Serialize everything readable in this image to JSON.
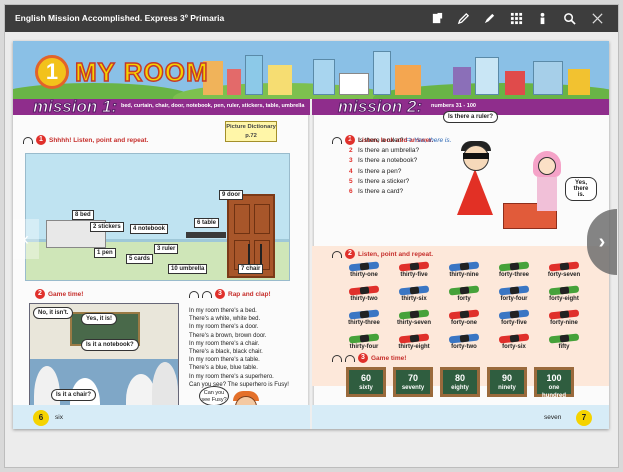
{
  "app": {
    "title": "English Mission Accomplished. Express 3º Primaria"
  },
  "toolbar": {
    "icons": [
      "notes-icon",
      "pencil-icon",
      "marker-icon",
      "grid-icon",
      "ruler-icon",
      "search-icon",
      "close-icon"
    ]
  },
  "left_page": {
    "unit_number": "1",
    "unit_title": "MY ROOM",
    "mission_title": "mission 1:",
    "mission_subtitle": "bed, curtain, chair, door, notebook, pen, ruler, stickers, table, umbrella",
    "exercise1": {
      "number": "1",
      "text": "Shhhh! Listen, point and repeat."
    },
    "picture_dictionary": "Picture Dictionary p.72",
    "room_labels": [
      "9 door",
      "8 bed",
      "2 stickers",
      "4 notebook",
      "6 table",
      "1 pen",
      "5 cards",
      "3 ruler",
      "10 umbrella",
      "7 chair"
    ],
    "exercise2": {
      "number": "2",
      "text": "Game time!"
    },
    "exercise3": {
      "number": "3",
      "text": "Rap and clap!"
    },
    "bubbles": [
      "No, it isn't.",
      "Yes, it is!",
      "Is it a notebook?",
      "Is it a chair?"
    ],
    "poem": [
      "In my room there's a bed.",
      "There's a white, white bed.",
      "In my room there's a door.",
      "There's a brown, brown door.",
      "In my room there's a chair.",
      "There's a black, black chair.",
      "In my room there's a table.",
      "There's a blue, blue table.",
      "In my room there's a superhero.",
      "Can you see? The superhero is Fusy!"
    ],
    "fusy_bubble": "Can you see Fusy?",
    "page_number": "6",
    "page_word": "six"
  },
  "right_page": {
    "mission_title": "mission 2:",
    "mission_subtitle": "numbers 31 - 100",
    "exercise1": {
      "number": "1",
      "text": "Listen, look and answer."
    },
    "question_bubble": "Is there a ruler?",
    "answer_bubble": "Yes, there is.",
    "questions": [
      {
        "n": "1",
        "q": "Is there a ruler?",
        "answer": "Yes, there is."
      },
      {
        "n": "2",
        "q": "Is there an umbrella?"
      },
      {
        "n": "3",
        "q": "Is there a notebook?"
      },
      {
        "n": "4",
        "q": "Is there a pen?"
      },
      {
        "n": "5",
        "q": "Is there a sticker?"
      },
      {
        "n": "6",
        "q": "Is there a card?"
      }
    ],
    "exercise2": {
      "number": "2",
      "text": "Listen, point and repeat."
    },
    "pencils": [
      {
        "word": "thirty-one",
        "color": "#3a76c4"
      },
      {
        "word": "thirty-five",
        "color": "#e0302b"
      },
      {
        "word": "thirty-nine",
        "color": "#3a76c4"
      },
      {
        "word": "forty-three",
        "color": "#46a23a"
      },
      {
        "word": "forty-seven",
        "color": "#e0302b"
      },
      {
        "word": "thirty-two",
        "color": "#e0302b"
      },
      {
        "word": "thirty-six",
        "color": "#3a76c4"
      },
      {
        "word": "forty",
        "color": "#46a23a"
      },
      {
        "word": "forty-four",
        "color": "#3a76c4"
      },
      {
        "word": "forty-eight",
        "color": "#46a23a"
      },
      {
        "word": "thirty-three",
        "color": "#3a76c4"
      },
      {
        "word": "thirty-seven",
        "color": "#46a23a"
      },
      {
        "word": "forty-one",
        "color": "#e0302b"
      },
      {
        "word": "forty-five",
        "color": "#3a76c4"
      },
      {
        "word": "forty-nine",
        "color": "#e0302b"
      },
      {
        "word": "thirty-four",
        "color": "#46a23a"
      },
      {
        "word": "thirty-eight",
        "color": "#e0302b"
      },
      {
        "word": "forty-two",
        "color": "#3a76c4"
      },
      {
        "word": "forty-six",
        "color": "#e0302b"
      },
      {
        "word": "fifty",
        "color": "#46a23a"
      }
    ],
    "exercise3": {
      "number": "3",
      "text": "Game time!"
    },
    "chalkboards": [
      {
        "n": "60",
        "w": "sixty"
      },
      {
        "n": "70",
        "w": "seventy"
      },
      {
        "n": "80",
        "w": "eighty"
      },
      {
        "n": "90",
        "w": "ninety"
      },
      {
        "n": "100",
        "w": "one hundred"
      }
    ],
    "page_number": "7",
    "page_word": "seven"
  },
  "navigation": {
    "prev_glyph": "‹",
    "next_glyph": "›"
  }
}
